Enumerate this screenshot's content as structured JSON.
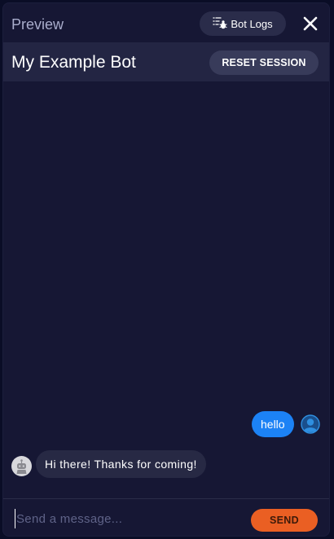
{
  "header": {
    "title": "Preview",
    "bot_logs_label": "Bot Logs",
    "bot_logs_icon": "bug-list-icon",
    "close_icon": "close-icon"
  },
  "bot": {
    "name": "My Example Bot",
    "reset_label": "RESET SESSION"
  },
  "messages": [
    {
      "from": "user",
      "text": "hello",
      "avatar_icon": "user-avatar-icon"
    },
    {
      "from": "bot",
      "text": "Hi there! Thanks for coming!",
      "avatar_icon": "bot-avatar-icon"
    }
  ],
  "composer": {
    "placeholder": "Send a message...",
    "value": "",
    "send_label": "SEND"
  },
  "colors": {
    "background": "#161734",
    "header_bar": "#232543",
    "user_bubble": "#1c82f5",
    "bot_bubble": "#272944",
    "send_button": "#ea5f23"
  }
}
